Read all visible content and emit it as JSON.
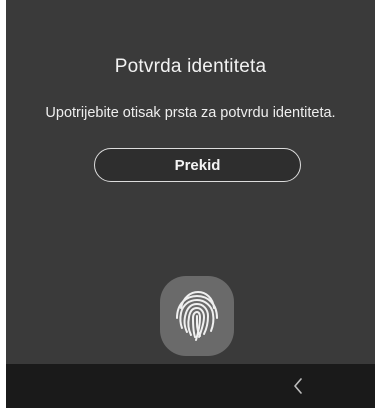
{
  "dialog": {
    "title": "Potvrda identiteta",
    "message": "Upotrijebite otisak prsta za potvrdu identiteta.",
    "cancel_label": "Prekid"
  },
  "fingerprint": {
    "icon": "fingerprint-icon"
  },
  "navigation": {
    "back_icon": "chevron-left-icon"
  },
  "colors": {
    "background": "#3a3a3a",
    "nav_bar": "#1a1a1a",
    "fingerprint_bg": "#6a6a6a",
    "text": "#f2f2f2"
  }
}
